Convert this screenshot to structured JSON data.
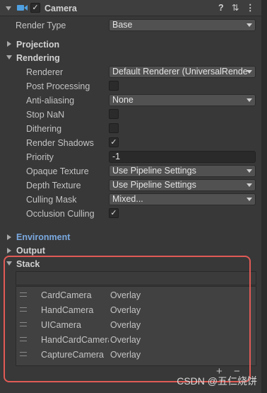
{
  "component": {
    "title": "Camera"
  },
  "header_icons": {
    "help": "?",
    "settings": "⇅",
    "more": "⋮"
  },
  "render_type": {
    "label": "Render Type",
    "value": "Base"
  },
  "sections": {
    "projection": "Projection",
    "rendering": "Rendering",
    "environment": "Environment",
    "output": "Output",
    "stack": "Stack"
  },
  "rendering": {
    "renderer": {
      "label": "Renderer",
      "value": "Default Renderer (UniversalRende"
    },
    "post_processing": {
      "label": "Post Processing",
      "checked": false
    },
    "anti_aliasing": {
      "label": "Anti-aliasing",
      "value": "None"
    },
    "stop_nan": {
      "label": "Stop NaN",
      "checked": false
    },
    "dithering": {
      "label": "Dithering",
      "checked": false
    },
    "render_shadows": {
      "label": "Render Shadows",
      "checked": true
    },
    "priority": {
      "label": "Priority",
      "value": "-1"
    },
    "opaque_texture": {
      "label": "Opaque Texture",
      "value": "Use Pipeline Settings"
    },
    "depth_texture": {
      "label": "Depth Texture",
      "value": "Use Pipeline Settings"
    },
    "culling_mask": {
      "label": "Culling Mask",
      "value": "Mixed..."
    },
    "occlusion_culling": {
      "label": "Occlusion Culling",
      "checked": true
    }
  },
  "stack": {
    "items": [
      {
        "name": "CardCamera",
        "type": "Overlay"
      },
      {
        "name": "HandCamera",
        "type": "Overlay"
      },
      {
        "name": "UICamera",
        "type": "Overlay"
      },
      {
        "name": "HandCardCamera",
        "type": "Overlay"
      },
      {
        "name": "CaptureCamera",
        "type": "Overlay"
      }
    ],
    "add_label": "+",
    "remove_label": "−"
  },
  "watermark": "CSDN @五仁烧饼",
  "colors": {
    "background": "#383838",
    "highlight_frame": "#e05a55",
    "link": "#7aa9e0"
  }
}
